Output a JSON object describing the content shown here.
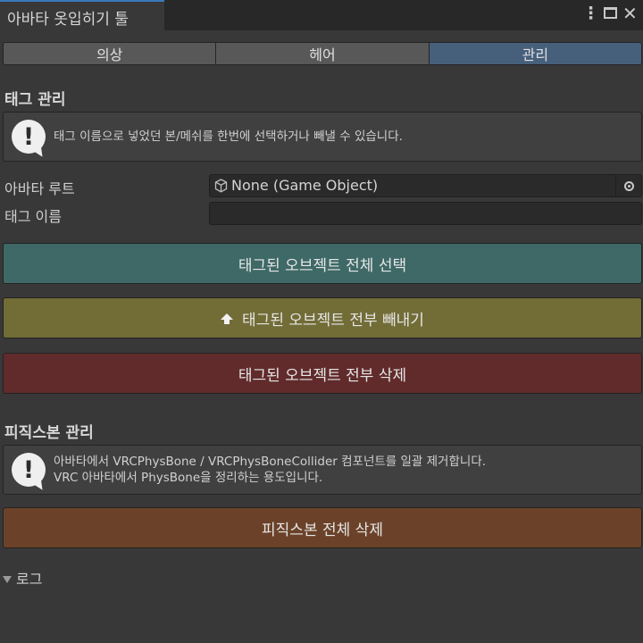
{
  "window": {
    "title": "아바타 옷입히기 툴",
    "menu_icon": "kebab-menu-icon",
    "maximize_icon": "maximize-icon",
    "close_icon": "close-icon"
  },
  "tabs": [
    {
      "label": "의상",
      "active": false
    },
    {
      "label": "헤어",
      "active": false
    },
    {
      "label": "관리",
      "active": true
    }
  ],
  "tag_section": {
    "title": "태그 관리",
    "help_icon": "info-exclamation-icon",
    "help": "태그 이름으로 넣었던 본/메쉬를 한번에 선택하거나 빼낼 수 있습니다.",
    "avatar_root_label": "아바타 루트",
    "avatar_root_value": "None (Game Object)",
    "tag_name_label": "태그 이름",
    "tag_name_value": "",
    "select_button": "태그된 오브젝트 전체 선택",
    "extract_button": "태그된 오브젝트 전부 빼내기",
    "delete_button": "태그된 오브젝트 전부 삭제"
  },
  "physbone_section": {
    "title": "피직스본 관리",
    "help_icon": "info-exclamation-icon",
    "help_line1": "아바타에서 VRCPhysBone / VRCPhysBoneCollider 컴포넌트를 일괄 제거합니다.",
    "help_line2": "VRC 아바타에서 PhysBone을 정리하는 용도입니다.",
    "delete_button": "피직스본 전체 삭제"
  },
  "log": {
    "label": "로그",
    "expanded": false
  },
  "colors": {
    "panel": "#383838",
    "tab_active": "#46607c",
    "btn_select": "#3e6967",
    "btn_extract": "#726c37",
    "btn_delete": "#612b2b",
    "btn_physbone_delete": "#6b4229"
  }
}
